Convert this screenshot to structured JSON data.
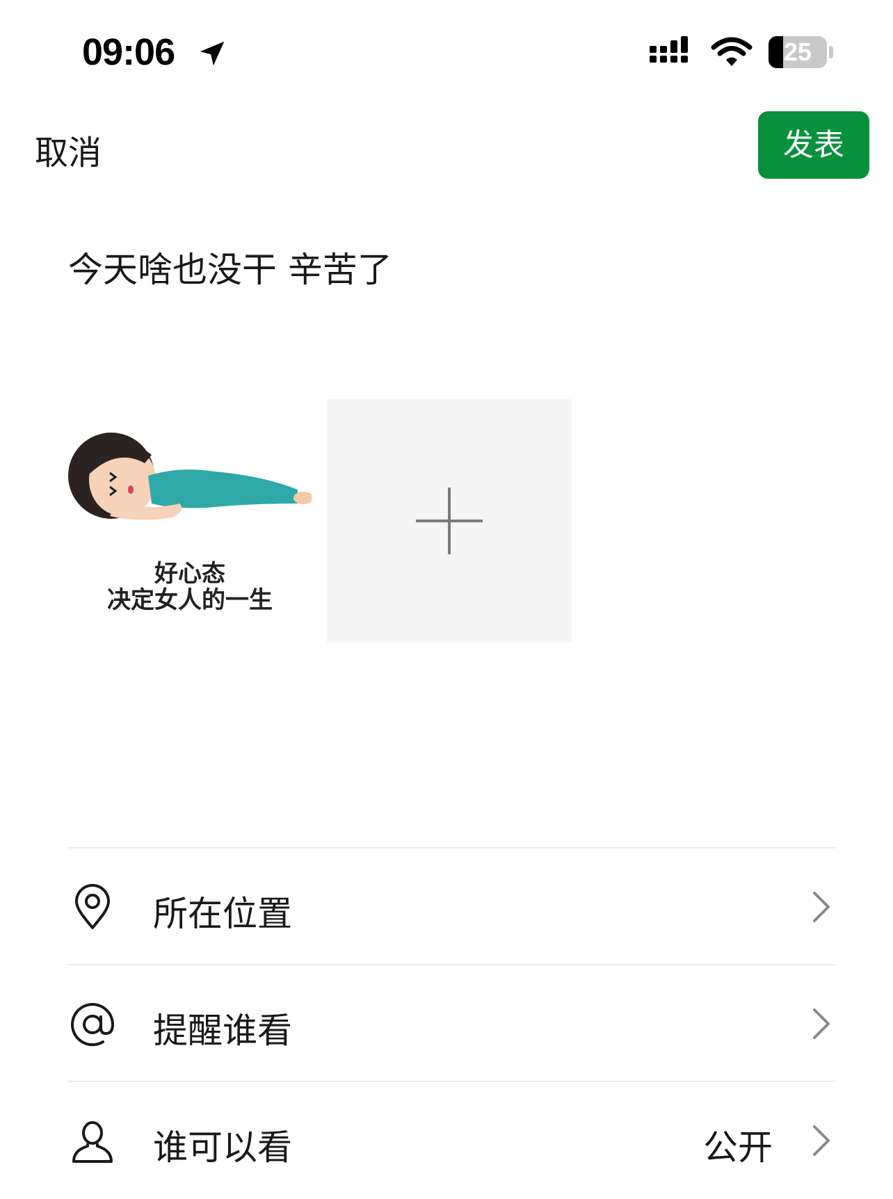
{
  "status_bar": {
    "time": "09:06",
    "battery_level": "25",
    "icons": [
      "location-arrow-icon",
      "signal-icon",
      "wifi-icon",
      "battery-icon"
    ]
  },
  "header": {
    "cancel_label": "取消",
    "publish_label": "发表",
    "publish_color": "#07913d"
  },
  "post": {
    "text": "今天啥也没干 辛苦了",
    "images": [
      {
        "type": "sticker",
        "caption_line1": "好心态",
        "caption_line2": "决定女人的一生"
      }
    ],
    "add_photo_icon": "plus-icon"
  },
  "options": [
    {
      "icon": "location-pin-icon",
      "label": "所在位置",
      "value": ""
    },
    {
      "icon": "at-sign-icon",
      "label": "提醒谁看",
      "value": ""
    },
    {
      "icon": "person-icon",
      "label": "谁可以看",
      "value": "公开"
    }
  ]
}
